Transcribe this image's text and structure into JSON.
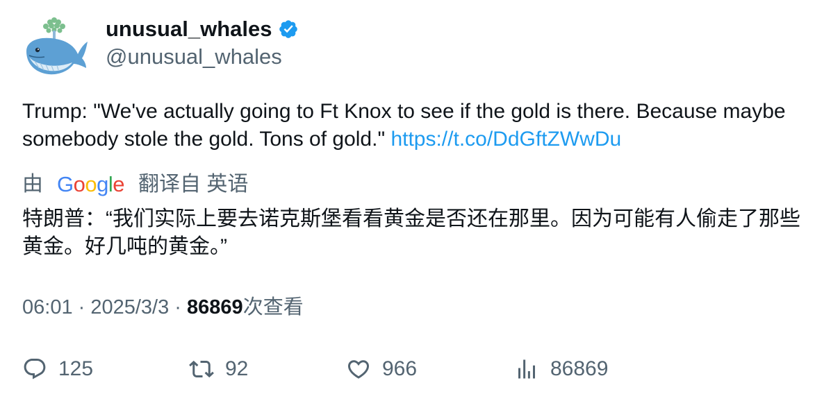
{
  "author": {
    "display_name": "unusual_whales",
    "handle": "@unusual_whales",
    "verified": true
  },
  "tweet": {
    "text": "Trump: \"We've actually going to Ft Knox to see if the gold is there. Because maybe somebody stole the gold. Tons of gold.\" ",
    "link": "https://t.co/DdGftZWwDu"
  },
  "translation": {
    "prefix": "由",
    "provider_letters": [
      "G",
      "o",
      "o",
      "g",
      "l",
      "e"
    ],
    "suffix": "翻译自 英语",
    "text": "特朗普：“我们实际上要去诺克斯堡看看黄金是否还在那里。因为可能有人偷走了那些黄金。好几吨的黄金。”"
  },
  "meta": {
    "time": "06:01",
    "separator": " · ",
    "date": "2025/3/3",
    "views_count": "86869",
    "views_label": "次查看"
  },
  "actions": {
    "replies": "125",
    "retweets": "92",
    "likes": "966",
    "views": "86869"
  },
  "colors": {
    "link": "#1d9bf0",
    "secondary_text": "#536471",
    "verified_badge": "#1d9bf0"
  },
  "icons": {
    "reply": "reply-icon",
    "retweet": "retweet-icon",
    "like": "heart-icon",
    "views": "analytics-icon",
    "verified": "verified-badge-icon",
    "avatar": "whale-avatar"
  }
}
